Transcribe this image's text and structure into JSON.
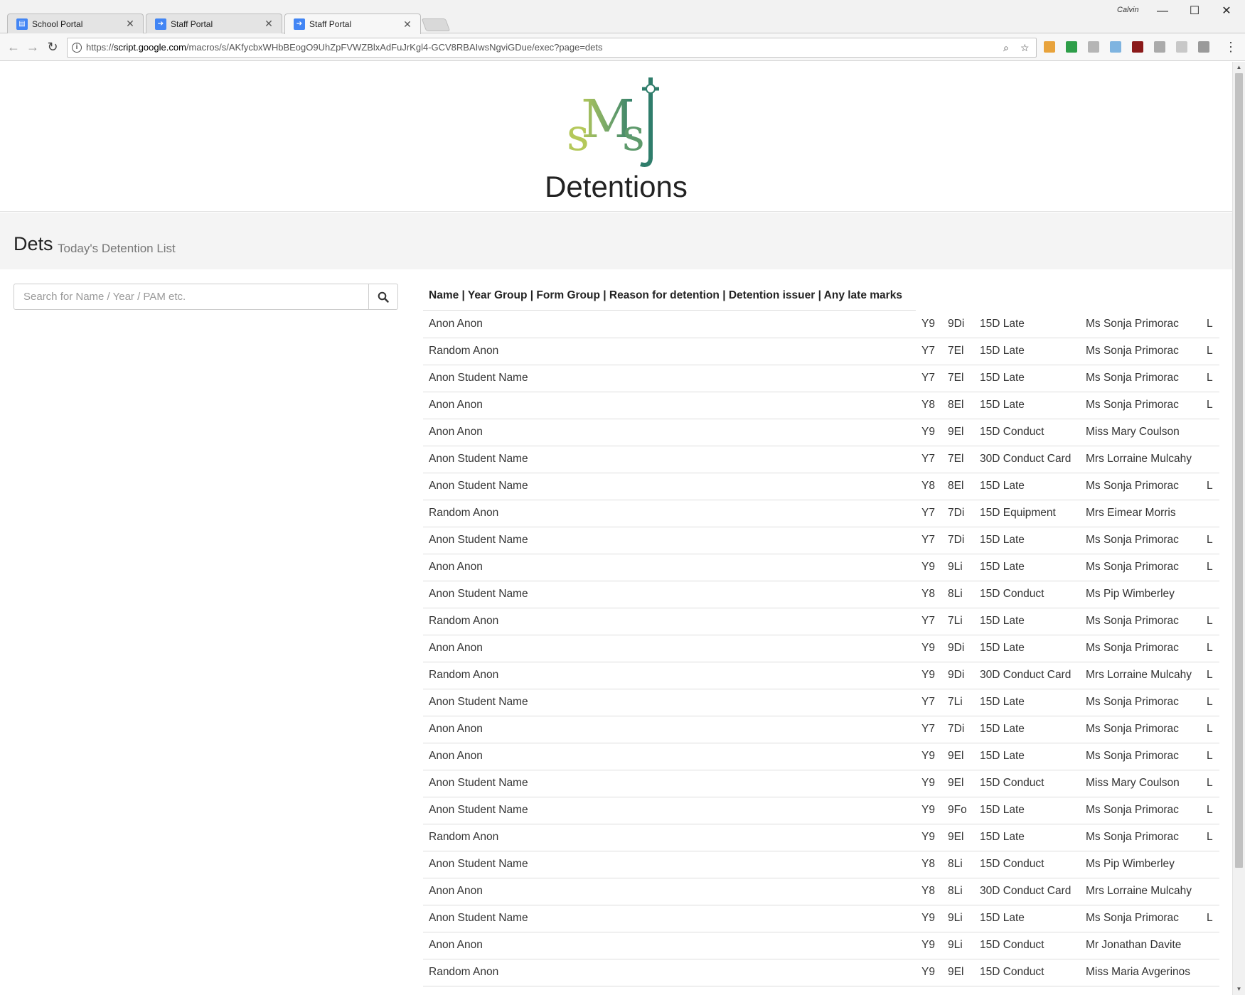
{
  "browser": {
    "tabs": [
      {
        "title": "School Portal",
        "close": "✕",
        "icon": "sites-icon",
        "color": "#4285f4"
      },
      {
        "title": "Staff Portal",
        "close": "✕",
        "icon": "apps-script-icon",
        "color": "#4285f4"
      },
      {
        "title": "Staff Portal",
        "close": "✕",
        "icon": "apps-script-icon",
        "color": "#4285f4"
      }
    ],
    "profile_name": "Calvin",
    "url_prefix": "https://",
    "url_host": "script.google.com",
    "url_path": "/macros/s/AKfycbxWHbBEogO9UhZpFVWZBlxAdFuJrKgl4-GCV8RBAIwsNgviGDue/exec?page=dets"
  },
  "header": {
    "title": "Detentions"
  },
  "jumbotron": {
    "heading": "Dets",
    "subheading": "Today's Detention List"
  },
  "search": {
    "placeholder": "Search for Name / Year / PAM etc."
  },
  "list": {
    "header": "Name | Year Group | Form Group | Reason for detention | Detention issuer | Any late marks",
    "rows": [
      {
        "name": "Anon Anon",
        "year": "Y9",
        "form": "9Di",
        "reason": "15D Late",
        "issuer": "Ms Sonja Primorac",
        "late": "L"
      },
      {
        "name": "Random Anon",
        "year": "Y7",
        "form": "7El",
        "reason": "15D Late",
        "issuer": "Ms Sonja Primorac",
        "late": "L"
      },
      {
        "name": "Anon Student Name",
        "year": "Y7",
        "form": "7El",
        "reason": "15D Late",
        "issuer": "Ms Sonja Primorac",
        "late": "L"
      },
      {
        "name": "Anon Anon",
        "year": "Y8",
        "form": "8El",
        "reason": "15D Late",
        "issuer": "Ms Sonja Primorac",
        "late": "L"
      },
      {
        "name": "Anon Anon",
        "year": "Y9",
        "form": "9El",
        "reason": "15D Conduct",
        "issuer": "Miss Mary Coulson",
        "late": ""
      },
      {
        "name": "Anon Student Name",
        "year": "Y7",
        "form": "7El",
        "reason": "30D Conduct Card",
        "issuer": "Mrs Lorraine Mulcahy",
        "late": ""
      },
      {
        "name": "Anon Student Name",
        "year": "Y8",
        "form": "8El",
        "reason": "15D Late",
        "issuer": "Ms Sonja Primorac",
        "late": "L"
      },
      {
        "name": "Random Anon",
        "year": "Y7",
        "form": "7Di",
        "reason": "15D Equipment",
        "issuer": "Mrs Eimear Morris",
        "late": ""
      },
      {
        "name": "Anon Student Name",
        "year": "Y7",
        "form": "7Di",
        "reason": "15D Late",
        "issuer": "Ms Sonja Primorac",
        "late": "L"
      },
      {
        "name": "Anon Anon",
        "year": "Y9",
        "form": "9Li",
        "reason": "15D Late",
        "issuer": "Ms Sonja Primorac",
        "late": "L"
      },
      {
        "name": "Anon Student Name",
        "year": "Y8",
        "form": "8Li",
        "reason": "15D Conduct",
        "issuer": "Ms Pip Wimberley",
        "late": ""
      },
      {
        "name": "Random Anon",
        "year": "Y7",
        "form": "7Li",
        "reason": "15D Late",
        "issuer": "Ms Sonja Primorac",
        "late": "L"
      },
      {
        "name": "Anon Anon",
        "year": "Y9",
        "form": "9Di",
        "reason": "15D Late",
        "issuer": "Ms Sonja Primorac",
        "late": "L"
      },
      {
        "name": "Random Anon",
        "year": "Y9",
        "form": "9Di",
        "reason": "30D Conduct Card",
        "issuer": "Mrs Lorraine Mulcahy",
        "late": "L"
      },
      {
        "name": "Anon Student Name",
        "year": "Y7",
        "form": "7Li",
        "reason": "15D Late",
        "issuer": "Ms Sonja Primorac",
        "late": "L"
      },
      {
        "name": "Anon Anon",
        "year": "Y7",
        "form": "7Di",
        "reason": "15D Late",
        "issuer": "Ms Sonja Primorac",
        "late": "L"
      },
      {
        "name": "Anon Anon",
        "year": "Y9",
        "form": "9El",
        "reason": "15D Late",
        "issuer": "Ms Sonja Primorac",
        "late": "L"
      },
      {
        "name": "Anon Student Name",
        "year": "Y9",
        "form": "9El",
        "reason": "15D Conduct",
        "issuer": "Miss Mary Coulson",
        "late": "L"
      },
      {
        "name": "Anon Student Name",
        "year": "Y9",
        "form": "9Fo",
        "reason": "15D Late",
        "issuer": "Ms Sonja Primorac",
        "late": "L"
      },
      {
        "name": "Random Anon",
        "year": "Y9",
        "form": "9El",
        "reason": "15D Late",
        "issuer": "Ms Sonja Primorac",
        "late": "L"
      },
      {
        "name": "Anon Student Name",
        "year": "Y8",
        "form": "8Li",
        "reason": "15D Conduct",
        "issuer": "Ms Pip Wimberley",
        "late": ""
      },
      {
        "name": "Anon Anon",
        "year": "Y8",
        "form": "8Li",
        "reason": "30D Conduct Card",
        "issuer": "Mrs Lorraine Mulcahy",
        "late": ""
      },
      {
        "name": "Anon Student Name",
        "year": "Y9",
        "form": "9Li",
        "reason": "15D Late",
        "issuer": "Ms Sonja Primorac",
        "late": "L"
      },
      {
        "name": "Anon Anon",
        "year": "Y9",
        "form": "9Li",
        "reason": "15D Conduct",
        "issuer": "Mr Jonathan Davite",
        "late": ""
      },
      {
        "name": "Random Anon",
        "year": "Y9",
        "form": "9El",
        "reason": "15D Conduct",
        "issuer": "Miss Maria Avgerinos",
        "late": ""
      }
    ]
  },
  "logo": {
    "text": "sMsj",
    "color_light": "#a8bf4e",
    "color_dark": "#2f7d6b"
  }
}
